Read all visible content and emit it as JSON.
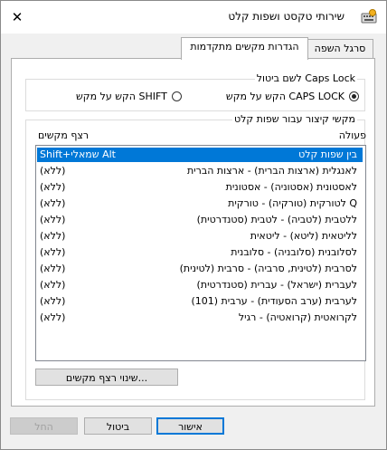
{
  "window": {
    "title": "שירותי טקסט ושפות קלט",
    "close_glyph": "✕"
  },
  "tabs": [
    {
      "label": "סרגל השפה",
      "active": false
    },
    {
      "label": "הגדרות מקשים מתקדמות",
      "active": true
    }
  ],
  "caps_lock": {
    "legend": "לשם ביטול Caps Lock",
    "options": [
      {
        "label": "הקש על מקש CAPS LOCK",
        "selected": true
      },
      {
        "label": "הקש על מקש SHIFT",
        "selected": false
      }
    ]
  },
  "hotkeys": {
    "legend": "מקשי קיצור עבור שפות קלט",
    "column_action": "פעולה",
    "column_keys": "רצף מקשים",
    "rows": [
      {
        "action": "בין שפות קלט",
        "keys": "Shift+שמאלי Alt",
        "selected": true
      },
      {
        "action": "לאנגלית (ארצות הברית) - ארצות הברית",
        "keys": "(ללא)",
        "selected": false
      },
      {
        "action": "לאסטונית (אסטוניה) - אסטונית",
        "keys": "(ללא)",
        "selected": false
      },
      {
        "action": "לטורקית (טורקיה) - טורקית Q",
        "keys": "(ללא)",
        "selected": false
      },
      {
        "action": "ללטבית (לטביה) - לטבית (סטנדרטית)",
        "keys": "(ללא)",
        "selected": false
      },
      {
        "action": "לליטאית (ליטא) - ליטאית",
        "keys": "(ללא)",
        "selected": false
      },
      {
        "action": "לסלובנית (סלובניה) - סלובנית",
        "keys": "(ללא)",
        "selected": false
      },
      {
        "action": "לסרבית (לטינית, סרביה) - סרבית (לטינית)",
        "keys": "(ללא)",
        "selected": false
      },
      {
        "action": "לעברית (ישראל) - עברית (סטנדרטית)",
        "keys": "(ללא)",
        "selected": false
      },
      {
        "action": "לערבית (ערב הסעודית) - ערבית (101)",
        "keys": "(ללא)",
        "selected": false
      },
      {
        "action": "לקרואטית (קרואטיה) - רגיל",
        "keys": "(ללא)",
        "selected": false
      }
    ],
    "change_button": "שינוי רצף מקשים..."
  },
  "footer": {
    "ok": "אישור",
    "cancel": "ביטול",
    "apply": "החל"
  },
  "colors": {
    "selection": "#0078d7",
    "primary_border": "#0078d7"
  }
}
